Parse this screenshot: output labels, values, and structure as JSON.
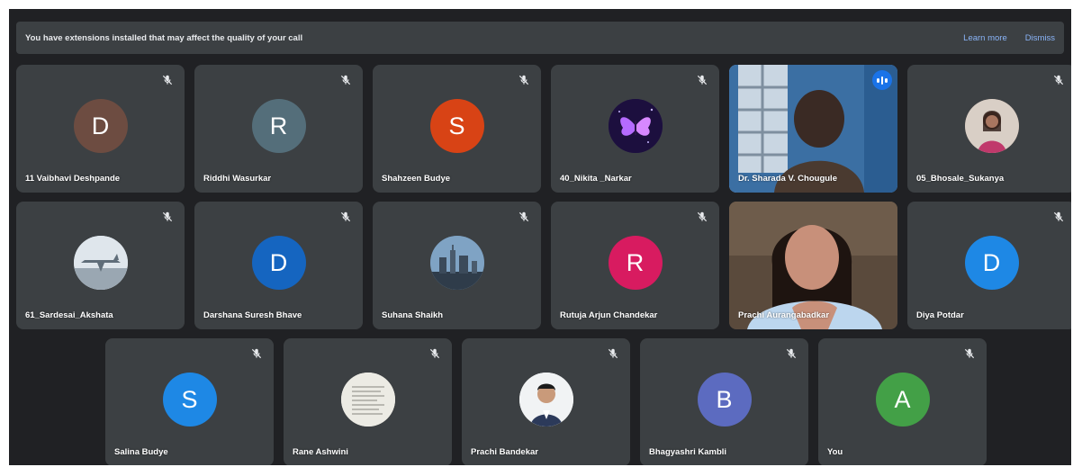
{
  "banner": {
    "text": "You have extensions installed that may affect the quality of your call",
    "learn_more": "Learn more",
    "dismiss": "Dismiss"
  },
  "participants": [
    {
      "name": "11 Vaibhavi Deshpande",
      "initial": "D",
      "color": "#6d4c41",
      "muted": true,
      "kind": "initial"
    },
    {
      "name": "Riddhi Wasurkar",
      "initial": "R",
      "color": "#546e7a",
      "muted": true,
      "kind": "initial"
    },
    {
      "name": "Shahzeen Budye",
      "initial": "S",
      "color": "#d84315",
      "muted": true,
      "kind": "initial"
    },
    {
      "name": "40_Nikita _Narkar",
      "initial": "",
      "color": "#2a1a55",
      "muted": true,
      "kind": "butterfly-photo"
    },
    {
      "name": "Dr. Sharada V. Chougule",
      "initial": "",
      "color": "",
      "muted": false,
      "kind": "video-window",
      "speaking": true
    },
    {
      "name": "05_Bhosale_Sukanya",
      "initial": "",
      "color": "#7a5a50",
      "muted": true,
      "kind": "person-photo"
    },
    {
      "name": "61_Sardesai_Akshata",
      "initial": "",
      "color": "#c9d3dc",
      "muted": true,
      "kind": "airplane-photo"
    },
    {
      "name": "Darshana Suresh Bhave",
      "initial": "D",
      "color": "#1565c0",
      "muted": true,
      "kind": "initial"
    },
    {
      "name": "Suhana Shaikh",
      "initial": "",
      "color": "#4a6078",
      "muted": true,
      "kind": "city-photo"
    },
    {
      "name": "Rutuja Arjun Chandekar",
      "initial": "R",
      "color": "#d81b60",
      "muted": true,
      "kind": "initial"
    },
    {
      "name": "Prachi Aurangabadkar",
      "initial": "",
      "color": "",
      "muted": false,
      "kind": "video-person"
    },
    {
      "name": "Diya Potdar",
      "initial": "D",
      "color": "#1e88e5",
      "muted": true,
      "kind": "initial"
    },
    {
      "name": "Salina Budye",
      "initial": "S",
      "color": "#1e88e5",
      "muted": true,
      "kind": "initial"
    },
    {
      "name": "Rane Ashwini",
      "initial": "",
      "color": "#e8e6de",
      "muted": true,
      "kind": "document-photo"
    },
    {
      "name": "Prachi Bandekar",
      "initial": "",
      "color": "#f1f3f4",
      "muted": true,
      "kind": "portrait-photo"
    },
    {
      "name": "Bhagyashri Kambli",
      "initial": "B",
      "color": "#5c6bc0",
      "muted": true,
      "kind": "initial"
    },
    {
      "name": "You",
      "initial": "A",
      "color": "#43a047",
      "muted": true,
      "kind": "initial"
    }
  ]
}
